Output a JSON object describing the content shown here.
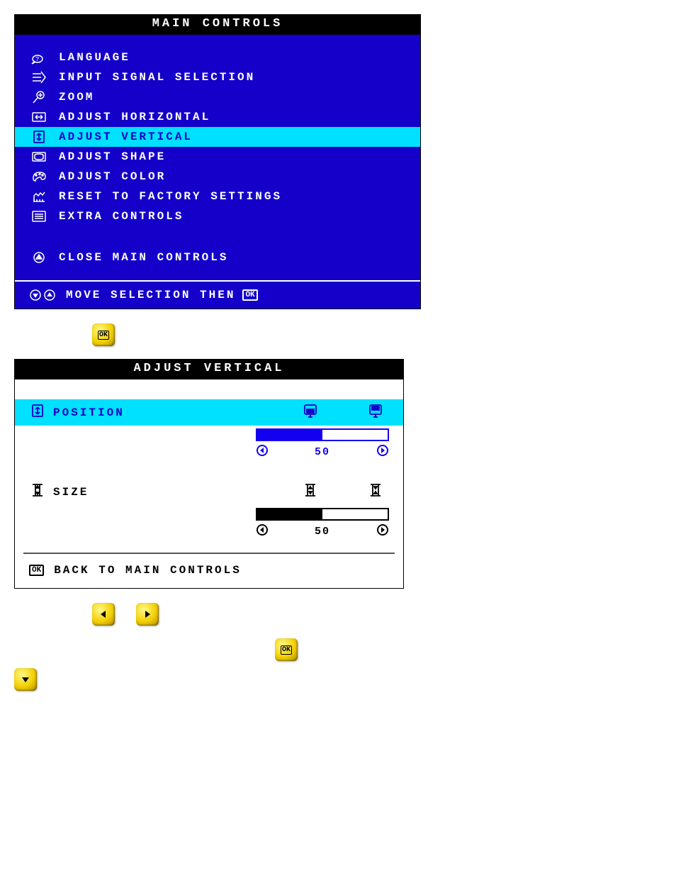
{
  "main_controls": {
    "title": "MAIN CONTROLS",
    "items": [
      {
        "icon": "language-icon",
        "label": "LANGUAGE"
      },
      {
        "icon": "input-icon",
        "label": "INPUT SIGNAL SELECTION"
      },
      {
        "icon": "zoom-icon",
        "label": "ZOOM"
      },
      {
        "icon": "adj-horiz-icon",
        "label": "ADJUST HORIZONTAL"
      },
      {
        "icon": "adj-vert-icon",
        "label": "ADJUST VERTICAL",
        "selected": true
      },
      {
        "icon": "adj-shape-icon",
        "label": "ADJUST SHAPE"
      },
      {
        "icon": "adj-color-icon",
        "label": "ADJUST COLOR"
      },
      {
        "icon": "reset-icon",
        "label": "RESET TO FACTORY SETTINGS"
      },
      {
        "icon": "extra-icon",
        "label": "EXTRA CONTROLS"
      }
    ],
    "close_label": "CLOSE MAIN CONTROLS",
    "hint_label": "MOVE SELECTION THEN",
    "hint_ok": "OK"
  },
  "adjust_vertical": {
    "title": "ADJUST VERTICAL",
    "position": {
      "label": "POSITION",
      "value": "50",
      "percent": 50
    },
    "size": {
      "label": "SIZE",
      "value": "50",
      "percent": 50
    },
    "back_label": "BACK TO MAIN CONTROLS",
    "back_ok": "OK"
  },
  "buttons": {
    "ok": "OK"
  }
}
